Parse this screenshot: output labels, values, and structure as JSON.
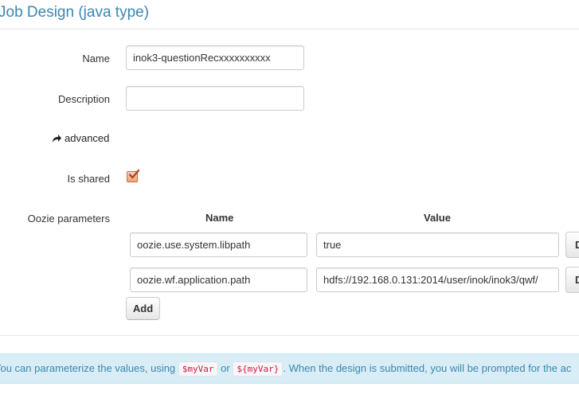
{
  "page": {
    "title": "Job Design (java type)"
  },
  "form": {
    "name_label": "Name",
    "name_value": "inok3-questionRecxxxxxxxxxx",
    "description_label": "Description",
    "description_value": "",
    "advanced_label": "advanced",
    "is_shared_label": "Is shared",
    "is_shared_checked": true,
    "oozie_label": "Oozie parameters"
  },
  "oozie": {
    "col_name": "Name",
    "col_value": "Value",
    "rows": [
      {
        "name": "oozie.use.system.libpath",
        "value": "true",
        "delete_label": "D"
      },
      {
        "name": "oozie.wf.application.path",
        "value": "hdfs://192.168.0.131:2014/user/inok/inok3/qwf/",
        "delete_label": "D"
      }
    ],
    "add_label": "Add"
  },
  "info": {
    "text_before": "You can parameterize the values, using",
    "code1": "$myVar",
    "text_or": "or",
    "code2": "${myVar}",
    "text_after": ". When the design is submitted, you will be prompted for the ac"
  },
  "colors": {
    "accent": "#3a87ad",
    "info_bg": "#d9edf7",
    "checkbox": "#c96a36"
  },
  "icons": {
    "advanced": "share-arrow-icon",
    "checkbox": "check-icon"
  }
}
